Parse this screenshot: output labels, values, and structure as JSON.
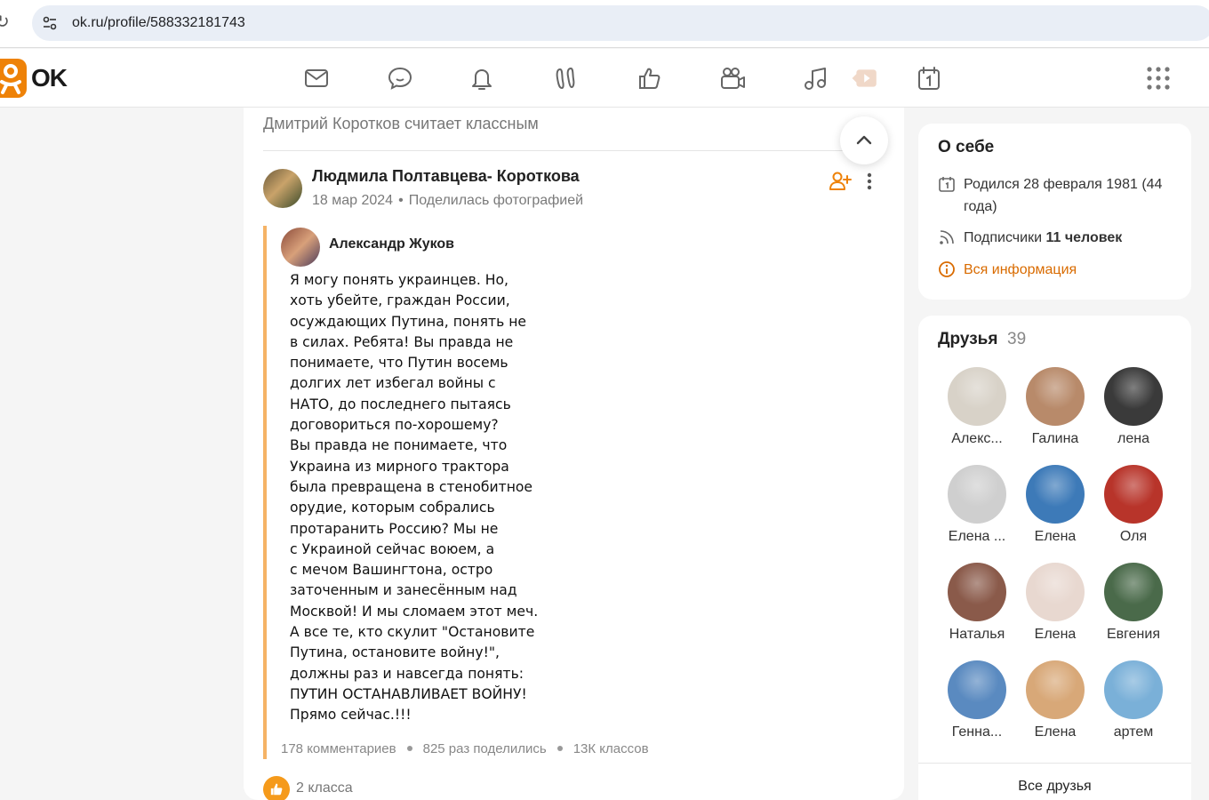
{
  "browser": {
    "url": "ok.ru/profile/588332181743"
  },
  "header": {
    "logo_text": "OK",
    "nav_icons": [
      "mail-icon",
      "chat-icon",
      "bell-icon",
      "guests-icon",
      "likes-icon",
      "video-camera-icon",
      "music-icon",
      "video-play-icon",
      "calendar-icon"
    ],
    "accent_color": "#ee8208"
  },
  "feed": {
    "liked_by": "Дмитрий Коротков считает классным",
    "author_name": "Людмила Полтавцева- Короткова",
    "post_date": "18 мар 2024",
    "post_action": "Поделилась фотографией",
    "original_author": "Александр Жуков",
    "post_text": "Я могу понять украинцев. Но,\nхоть убейте, граждан России,\nосуждающих Путина, понять не\nв силах. Ребята! Вы правда не\nпонимаете, что Путин восемь\nдолгих лет избегал войны с\nНАТО, до последнего пытаясь\nдоговориться по-хорошему?\nВы правда не понимаете, что\nУкраина из мирного трактора\nбыла превращена в стенобитное\nорудие, которым собрались\nпротаранить Россию? Мы не\nс Украиной сейчас воюем, а\nс мечом Вашингтона, остро\nзаточенным и занесённым над\nМосквой! И мы сломаем этот меч.\nА все те, кто скулит \"Остановите\nПутина, остановите войну!\",\nдолжны раз и навсегда понять:\nПУТИН ОСТАНАВЛИВАЕТ ВОЙНУ!\nПрямо сейчас.!!!",
    "stats": {
      "comments": "178 комментариев",
      "shares": "825 раз поделились",
      "likes": "13К классов"
    },
    "like_count": "2 класса"
  },
  "about": {
    "title": "О себе",
    "birth": "Родился 28 февраля 1981 (44 года)",
    "followers_label": "Подписчики",
    "followers_value": "11 человек",
    "all_info": "Вся информация"
  },
  "friends": {
    "title": "Друзья",
    "count": "39",
    "list": [
      {
        "name": "Алекс...",
        "color": "#d8d2c8"
      },
      {
        "name": "Галина",
        "color": "#b88a6a"
      },
      {
        "name": "лена",
        "color": "#3a3a3a"
      },
      {
        "name": "Елена ...",
        "color": "#cfcfcf"
      },
      {
        "name": "Елена",
        "color": "#3d7ab8"
      },
      {
        "name": "Оля",
        "color": "#b8342a"
      },
      {
        "name": "Наталья",
        "color": "#8a5a4a"
      },
      {
        "name": "Елена",
        "color": "#e8d8d0"
      },
      {
        "name": "Евгения",
        "color": "#4a6a4a"
      },
      {
        "name": "Генна...",
        "color": "#5a8ac0"
      },
      {
        "name": "Елена",
        "color": "#d8a878"
      },
      {
        "name": "артем",
        "color": "#7ab0d8"
      }
    ],
    "all_friends": "Все друзья"
  }
}
